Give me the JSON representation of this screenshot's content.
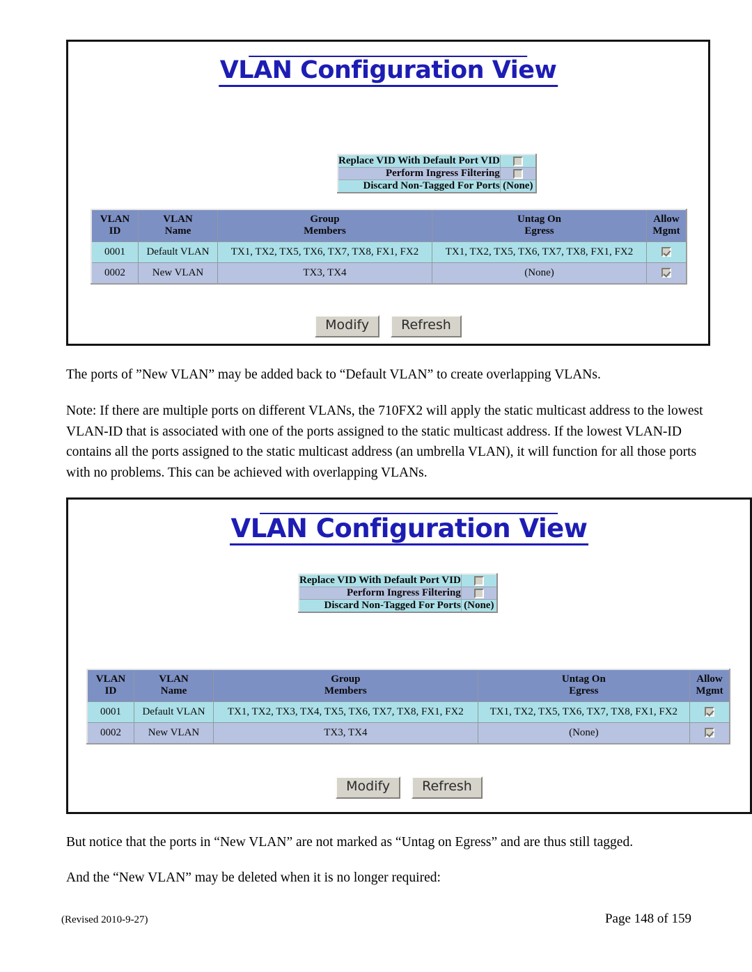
{
  "document": {
    "paragraphs": [
      "The ports of ”New VLAN” may be added back to “Default VLAN” to create overlapping VLANs.",
      "Note: If there are multiple ports on different VLANs, the 710FX2 will apply the static multicast address to the lowest VLAN-ID that is associated with one of the ports assigned to the static multicast address.  If the lowest VLAN-ID contains all the ports assigned to the static multicast address (an umbrella VLAN), it will function for all those ports with no problems.  This can be achieved with overlapping VLANs.",
      "But notice that the ports in “New VLAN” are not marked as “Untag on Egress” and are thus still tagged.",
      "And the “New VLAN” may be deleted when it is no longer required:"
    ],
    "footer": {
      "revision": "(Revised 2010-9-27)",
      "page": "Page 148 of 159"
    }
  },
  "colors": {
    "title": "#1d1db4",
    "table_header": "#7d90c4",
    "row_cyan": "#ace0e8",
    "row_blue": "#b7c3e0",
    "button_face": "#d6d3cb"
  },
  "screenshot_1": {
    "title": "VLAN Configuration View",
    "options": {
      "rows": [
        {
          "label": "Replace VID With Default Port VID",
          "type": "checkbox",
          "checked": false
        },
        {
          "label": "Perform Ingress Filtering",
          "type": "checkbox",
          "checked": false
        },
        {
          "label": "Discard Non-Tagged For Ports",
          "type": "text",
          "value": "(None)"
        }
      ]
    },
    "table": {
      "headers": [
        {
          "line1": "VLAN",
          "line2": "ID"
        },
        {
          "line1": "VLAN",
          "line2": "Name"
        },
        {
          "line1": "Group",
          "line2": "Members"
        },
        {
          "line1": "Untag On",
          "line2": "Egress"
        },
        {
          "line1": "Allow",
          "line2": "Mgmt"
        }
      ],
      "rows": [
        {
          "vlan_id": "0001",
          "vlan_name": "Default VLAN",
          "group_members": "TX1, TX2, TX5, TX6, TX7, TX8, FX1, FX2",
          "untag_on_egress": "TX1, TX2, TX5, TX6, TX7, TX8, FX1, FX2",
          "allow_mgmt": true
        },
        {
          "vlan_id": "0002",
          "vlan_name": "New VLAN",
          "group_members": "TX3, TX4",
          "untag_on_egress": "(None)",
          "allow_mgmt": true
        }
      ]
    },
    "buttons": {
      "modify": "Modify",
      "refresh": "Refresh"
    }
  },
  "screenshot_2": {
    "title": "VLAN Configuration View",
    "options": {
      "rows": [
        {
          "label": "Replace VID With Default Port VID",
          "type": "checkbox",
          "checked": false
        },
        {
          "label": "Perform Ingress Filtering",
          "type": "checkbox",
          "checked": false
        },
        {
          "label": "Discard Non-Tagged For Ports",
          "type": "text",
          "value": "(None)"
        }
      ]
    },
    "table": {
      "headers": [
        {
          "line1": "VLAN",
          "line2": "ID"
        },
        {
          "line1": "VLAN",
          "line2": "Name"
        },
        {
          "line1": "Group",
          "line2": "Members"
        },
        {
          "line1": "Untag On",
          "line2": "Egress"
        },
        {
          "line1": "Allow",
          "line2": "Mgmt"
        }
      ],
      "rows": [
        {
          "vlan_id": "0001",
          "vlan_name": "Default VLAN",
          "group_members": "TX1, TX2, TX3, TX4, TX5, TX6, TX7, TX8, FX1, FX2",
          "untag_on_egress": "TX1, TX2, TX5, TX6, TX7, TX8, FX1, FX2",
          "allow_mgmt": true
        },
        {
          "vlan_id": "0002",
          "vlan_name": "New VLAN",
          "group_members": "TX3, TX4",
          "untag_on_egress": "(None)",
          "allow_mgmt": true
        }
      ]
    },
    "buttons": {
      "modify": "Modify",
      "refresh": "Refresh"
    }
  }
}
